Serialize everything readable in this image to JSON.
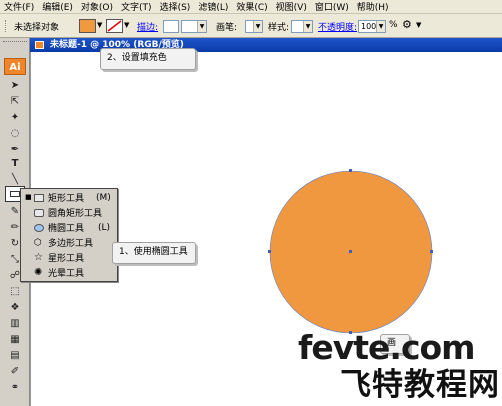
{
  "menu": [
    "文件(F)",
    "编辑(E)",
    "对象(O)",
    "文字(T)",
    "选择(S)",
    "滤镜(L)",
    "效果(C)",
    "视图(V)",
    "窗口(W)",
    "帮助(H)"
  ],
  "control": {
    "selection_label": "未选择对象",
    "stroke_label": "描边:",
    "brush_label": "画笔:",
    "style_label": "样式:",
    "opacity_label": "不透明度:",
    "opacity_value": "100",
    "opacity_unit": "%",
    "fill_color": "#f0993e"
  },
  "app_logo": "Ai",
  "document": {
    "title": "未标题-1 @ 100% (RGB/预览)",
    "circle_color": "#f0983f"
  },
  "flyout": {
    "items": [
      {
        "label": "矩形工具",
        "shortcut": "(M)",
        "icon": "rectangle-icon"
      },
      {
        "label": "圆角矩形工具",
        "shortcut": "",
        "icon": "rounded-rectangle-icon"
      },
      {
        "label": "椭圆工具",
        "shortcut": "(L)",
        "icon": "ellipse-icon"
      },
      {
        "label": "多边形工具",
        "shortcut": "",
        "icon": "polygon-icon"
      },
      {
        "label": "星形工具",
        "shortcut": "",
        "icon": "star-icon"
      },
      {
        "label": "光晕工具",
        "shortcut": "",
        "icon": "flare-icon"
      }
    ]
  },
  "callouts": {
    "set_fill": "2、设置填充色",
    "use_ellipse": "1、使用椭圆工具",
    "draw": "画"
  },
  "watermark": {
    "domain": "fevte.com",
    "site_name": "飞特教程网"
  }
}
